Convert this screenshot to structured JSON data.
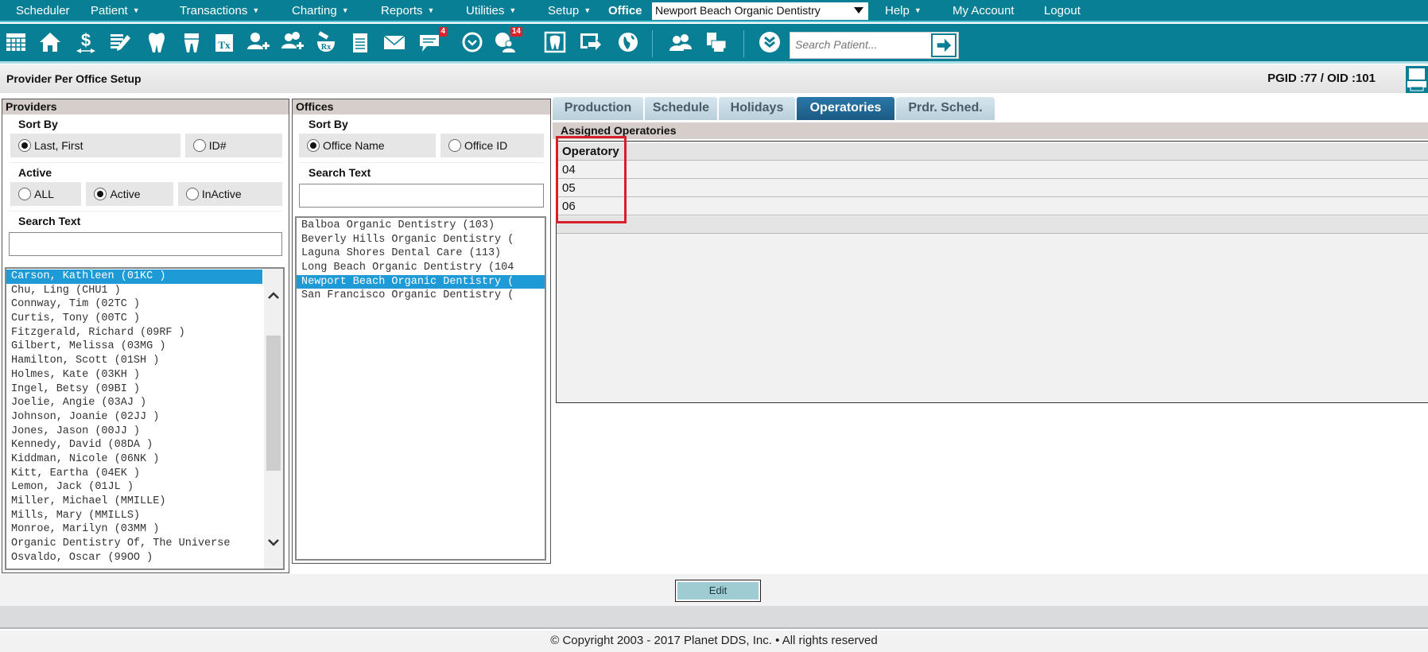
{
  "menu": {
    "items": [
      {
        "label": "Scheduler",
        "caret": false
      },
      {
        "label": "Patient",
        "caret": true
      },
      {
        "label": "Transactions",
        "caret": true
      },
      {
        "label": "Charting",
        "caret": true
      },
      {
        "label": "Reports",
        "caret": true
      },
      {
        "label": "Utilities",
        "caret": true
      },
      {
        "label": "Setup",
        "caret": true
      }
    ],
    "office_label": "Office",
    "office_selected": "Newport Beach Organic Dentistry",
    "help": "Help",
    "my_account": "My Account",
    "logout": "Logout",
    "caret": "▼"
  },
  "toolbar": {
    "icons": [
      "calendar-icon",
      "home-icon",
      "dollar-transfer-icon",
      "notes-edit-icon",
      "tooth-icon",
      "crown-tooth-icon",
      "treatment-tx-icon",
      "add-patient-icon",
      "add-family-icon",
      "prescription-rx-icon",
      "notepad-icon",
      "mail-icon",
      "messages-icon",
      "clock-icon",
      "online-users-icon",
      "tooth-frame-icon",
      "export-screen-icon",
      "globe-icon",
      "group-icon",
      "print-docs-icon",
      "expand-circle-icon"
    ],
    "messages_badge": "4",
    "online_badge": "14",
    "search_placeholder": "Search Patient..."
  },
  "page": {
    "title": "Provider Per Office Setup",
    "ids": "PGID :77  /  OID :101"
  },
  "providers": {
    "header": "Providers",
    "sort_label": "Sort By",
    "sort_options": [
      {
        "label": "Last, First",
        "checked": true
      },
      {
        "label": "ID#",
        "checked": false
      }
    ],
    "active_label": "Active",
    "active_options": [
      {
        "label": "ALL",
        "checked": false
      },
      {
        "label": "Active",
        "checked": true
      },
      {
        "label": "InActive",
        "checked": false
      }
    ],
    "search_label": "Search Text",
    "search_value": "",
    "list": [
      "Carson, Kathleen (01KC )",
      "Chu, Ling (CHU1 )",
      "Connway, Tim (02TC )",
      "Curtis, Tony (00TC )",
      "Fitzgerald, Richard (09RF )",
      "Gilbert, Melissa (03MG )",
      "Hamilton, Scott (01SH )",
      "Holmes, Kate (03KH )",
      "Ingel, Betsy (09BI )",
      "Joelie, Angie (03AJ )",
      "Johnson, Joanie (02JJ )",
      "Jones, Jason (00JJ )",
      "Kennedy, David (08DA )",
      "Kiddman, Nicole (06NK )",
      "Kitt, Eartha (04EK )",
      "Lemon, Jack (01JL )",
      "Miller, Michael (MMILLE)",
      "Mills, Mary (MMILLS)",
      "Monroe, Marilyn (03MM )",
      "Organic Dentistry Of, The Universe",
      "Osvaldo, Oscar (99OO )"
    ],
    "selected_index": 0
  },
  "offices": {
    "header": "Offices",
    "sort_label": "Sort By",
    "sort_options": [
      {
        "label": "Office Name",
        "checked": true
      },
      {
        "label": "Office ID",
        "checked": false
      }
    ],
    "search_label": "Search Text",
    "search_value": "",
    "list": [
      "Balboa Organic Dentistry (103)",
      "Beverly Hills Organic Dentistry (",
      "Laguna Shores Dental Care (113)",
      "Long Beach Organic Dentistry (104",
      "Newport Beach Organic Dentistry (",
      "San Francisco Organic Dentistry ("
    ],
    "selected_index": 4
  },
  "tabs": [
    {
      "label": "Production",
      "active": false
    },
    {
      "label": "Schedule",
      "active": false
    },
    {
      "label": "Holidays",
      "active": false
    },
    {
      "label": "Operatories",
      "active": true
    },
    {
      "label": "Prdr. Sched.",
      "active": false
    }
  ],
  "operatories": {
    "header": "Assigned Operatories",
    "column": "Operatory",
    "rows": [
      "04",
      "05",
      "06"
    ]
  },
  "actions": {
    "edit": "Edit"
  },
  "footer": {
    "copyright": "© Copyright 2003 - 2017 Planet DDS, Inc. • All rights reserved"
  },
  "colors": {
    "brand": "#087f95",
    "selection": "#1e9ad6",
    "tab_active": "#1b5b85",
    "highlight": "#d61f2a"
  }
}
